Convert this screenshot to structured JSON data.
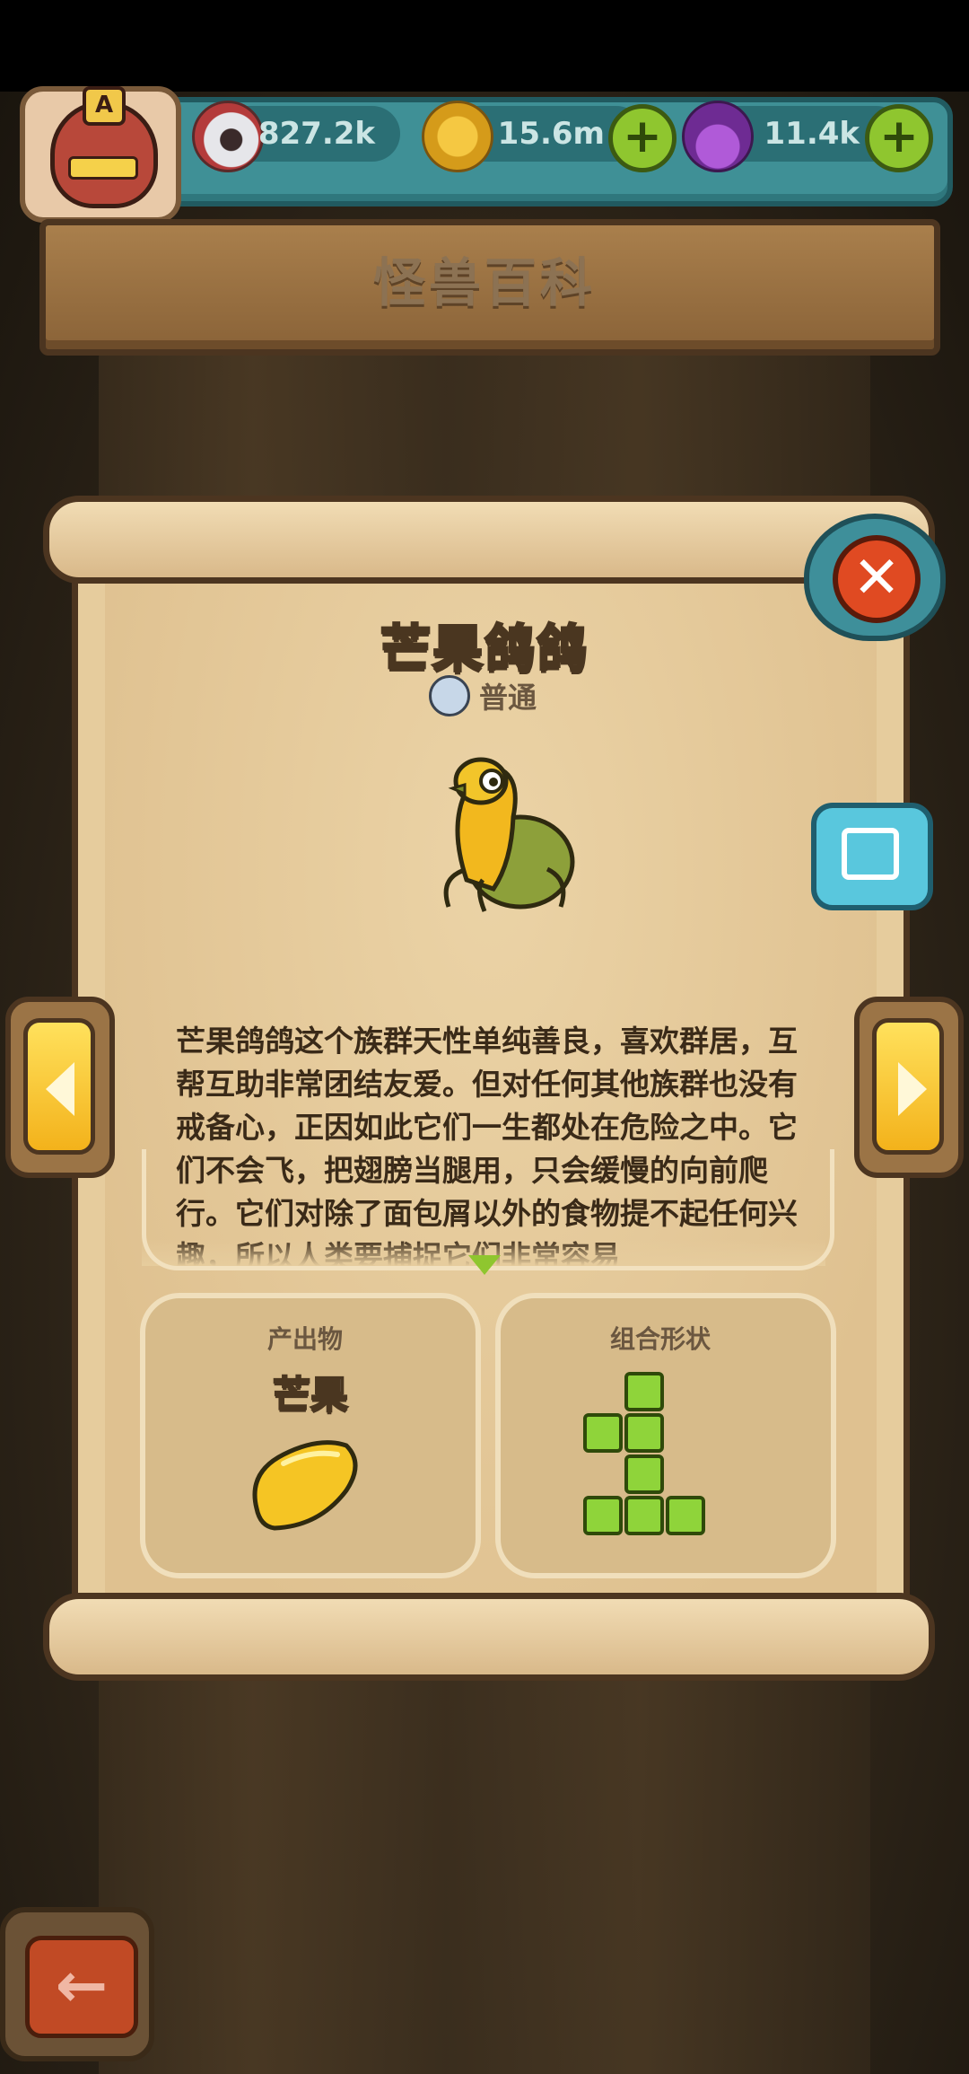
{
  "resources": {
    "eyes": {
      "value": "827.2k",
      "icon": "eyeball-icon"
    },
    "coins": {
      "value": "15.6m",
      "icon": "coin-icon"
    },
    "potions": {
      "value": "11.4k",
      "icon": "potion-icon"
    }
  },
  "player": {
    "avatar_badge": "A"
  },
  "header": {
    "title": "怪兽百科"
  },
  "monster": {
    "name": "芒果鸽鸽",
    "rarity": "普通",
    "description": "芒果鸽鸽这个族群天性单纯善良，喜欢群居，互帮互助非常团结友爱。但对任何其他族群也没有戒备心，正因如此它们一生都处在危险之中。它们不会飞，把翅膀当腿用，只会缓慢的向前爬行。它们对除了面包屑以外的食物提不起任何兴趣，所以人类要捕捉它们非常容易"
  },
  "product": {
    "label": "产出物",
    "name": "芒果"
  },
  "shape": {
    "label": "组合形状"
  },
  "buttons": {
    "close": "✕",
    "back": "←"
  },
  "colors": {
    "accent_green": "#8fc62f",
    "teal": "#3f9096",
    "close_red": "#e04a22"
  }
}
